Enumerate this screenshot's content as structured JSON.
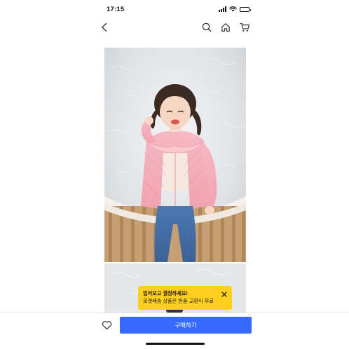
{
  "status_bar": {
    "time": "17:15",
    "battery_level": 0.6
  },
  "nav": {
    "icons": [
      "back-icon",
      "search-icon",
      "home-icon",
      "cart-icon"
    ]
  },
  "product": {
    "hero_image": "girl-in-pink-quilted-jacket-photo",
    "second_image": "frosted-glass-background-photo"
  },
  "toast": {
    "line1": "입어보고 결정하세요!",
    "line2": "로켓배송 상품은 반품·교환이 무료",
    "background_color": "#ffcf1f"
  },
  "bottom_bar": {
    "buy_label": "구매하기",
    "buy_color": "#346aff"
  }
}
